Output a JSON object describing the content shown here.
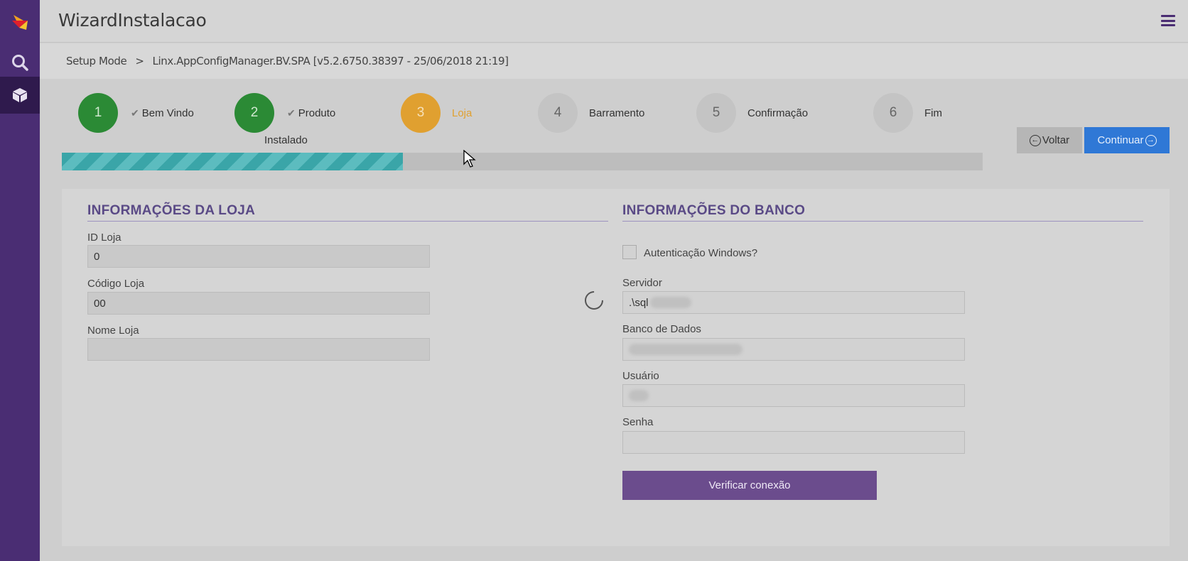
{
  "app": {
    "title": "WizardInstalacao"
  },
  "breadcrumb": {
    "root": "Setup Mode",
    "separator": ">",
    "current": "Linx.AppConfigManager.BV.SPA [v5.2.6750.38397 - 25/06/2018 21:19]"
  },
  "steps": [
    {
      "number": "1",
      "label": "Bem Vindo",
      "status": "done"
    },
    {
      "number": "2",
      "label": "Produto",
      "sublabel": "Instalado",
      "status": "done"
    },
    {
      "number": "3",
      "label": "Loja",
      "status": "current"
    },
    {
      "number": "4",
      "label": "Barramento",
      "status": "pending"
    },
    {
      "number": "5",
      "label": "Confirmação",
      "status": "pending"
    },
    {
      "number": "6",
      "label": "Fim",
      "status": "pending"
    }
  ],
  "progress": {
    "fraction": 0.37
  },
  "nav": {
    "back_label": "Voltar",
    "next_label": "Continuar"
  },
  "loja": {
    "title": "INFORMAÇÕES DA LOJA",
    "id_label": "ID Loja",
    "id_value": "0",
    "codigo_label": "Código Loja",
    "codigo_value": "00",
    "nome_label": "Nome Loja",
    "nome_value": ""
  },
  "banco": {
    "title": "INFORMAÇÕES DO BANCO",
    "auth_label": "Autenticação Windows?",
    "servidor_label": "Servidor",
    "servidor_value": ".\\sql",
    "banco_label": "Banco de Dados",
    "usuario_label": "Usuário",
    "senha_label": "Senha",
    "verify_label": "Verificar conexão"
  },
  "colors": {
    "sidebar": "#4a2d73",
    "accent": "#2f78d6",
    "done": "#2b8a35",
    "current": "#e0a030",
    "title": "#5a4a86"
  }
}
